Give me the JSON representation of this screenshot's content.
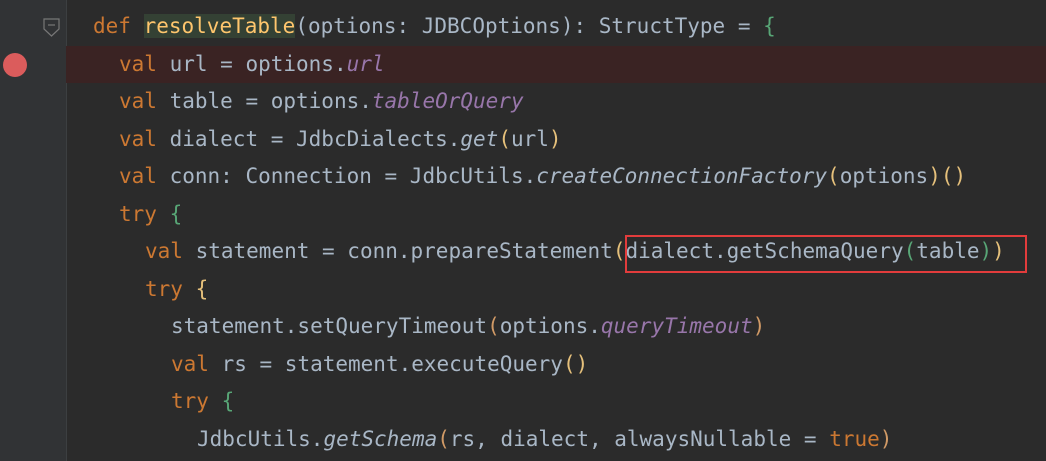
{
  "code": {
    "line1": {
      "kw": "def",
      "name": "resolveTable",
      "params": "(options: JDBCOptions): StructType = ",
      "brace": "{"
    },
    "line2": {
      "kw": "val",
      "pre": " url = options.",
      "field": "url"
    },
    "line3": {
      "kw": "val",
      "pre": " table = options.",
      "field": "tableOrQuery"
    },
    "line4": {
      "kw": "val",
      "pre": " dialect = JdbcDialects.",
      "static": "get",
      "paren_open": "(",
      "arg": "url",
      "paren_close": ")"
    },
    "line5": {
      "kw": "val",
      "pre": " conn: Connection = JdbcUtils.",
      "static": "createConnectionFactory",
      "paren_open": "(",
      "arg": "options",
      "paren_close": ")",
      "call": "()"
    },
    "line6": {
      "kw": "try",
      "brace": " {"
    },
    "line7": {
      "kw": "val",
      "pre": " statement = conn.prepareStatement",
      "boxed_open": "(",
      "boxed_text": "dialect.getSchemaQuery",
      "boxed_inner_open": "(",
      "boxed_arg": "table",
      "boxed_inner_close": ")",
      "boxed_close": ")"
    },
    "line8": {
      "kw": "try",
      "brace": " {"
    },
    "line9": {
      "pre": "statement.setQueryTimeout",
      "paren_open": "(",
      "arg": "options.",
      "field": "queryTimeout",
      "paren_close": ")"
    },
    "line10": {
      "kw": "val",
      "pre": " rs = statement.executeQuery",
      "call": "()"
    },
    "line11": {
      "kw": "try",
      "brace": " {"
    },
    "line12": {
      "pre": "JdbcUtils.",
      "static": "getSchema",
      "paren_open": "(",
      "args": "rs, dialect, alwaysNullable = ",
      "kw2": "true",
      "paren_close": ")"
    }
  },
  "colors": {
    "background": "#2b2b2b",
    "keyword": "#cc7832",
    "function": "#ffc66d",
    "field": "#9876aa",
    "text": "#a9b7c6",
    "breakpoint": "#db5c5c",
    "highlight_box": "#e23c3c"
  },
  "gutter": {
    "breakpoint_icon": "breakpoint-icon",
    "fold_icon": "fold-icon"
  }
}
